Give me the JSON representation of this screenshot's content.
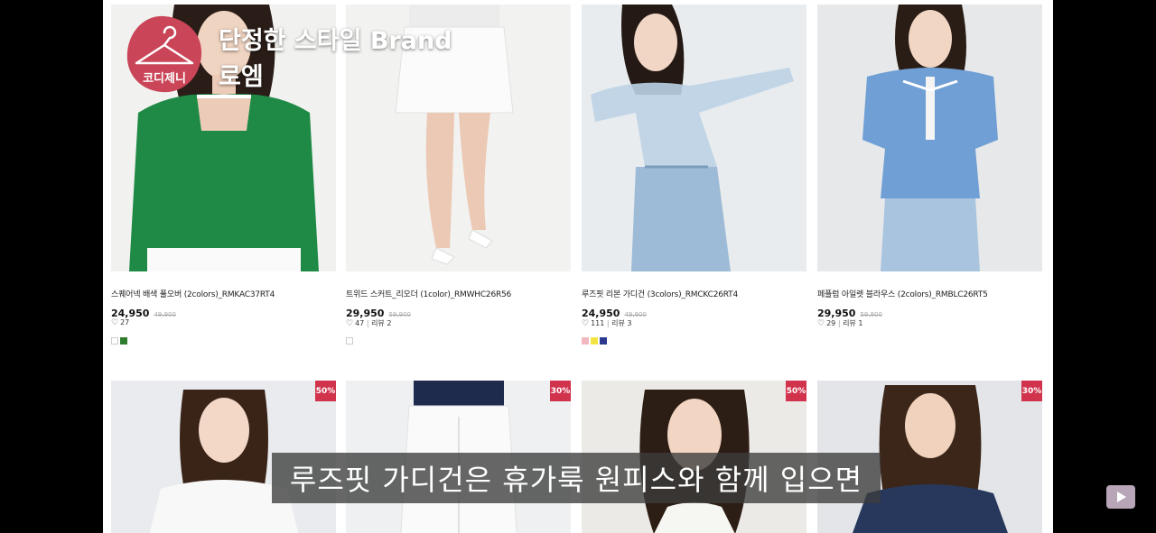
{
  "overlay": {
    "logo_text": "코디제니",
    "brand_title": "단정한 스타일 Brand",
    "brand_name": "로엠",
    "subtitle": "루즈핏 가디건은 휴가룩 원피스와 함께 입으면"
  },
  "products_row1": [
    {
      "name": "스퀘어넥 배색 풀오버 (2colors)_RMKAC37RT4",
      "sale_price": "24,950",
      "original_price": "49,900",
      "likes": "27",
      "reviews": "",
      "swatches": [
        "#ffffff",
        "#2e7d2e"
      ]
    },
    {
      "name": "트위드 스커트_리오더 (1color)_RMWHC26R56",
      "sale_price": "29,950",
      "original_price": "59,900",
      "likes": "47",
      "reviews": "리뷰 2",
      "swatches": [
        "#ffffff"
      ]
    },
    {
      "name": "루즈핏 리본 가디건 (3colors)_RMCKC26RT4",
      "sale_price": "24,950",
      "original_price": "49,900",
      "likes": "111",
      "reviews": "리뷰 3",
      "swatches": [
        "#f2b8c0",
        "#f2e440",
        "#2b3a8c"
      ]
    },
    {
      "name": "페플럼 아일렛 블라우스 (2colors)_RMBLC26RT5",
      "sale_price": "29,950",
      "original_price": "59,900",
      "likes": "29",
      "reviews": "리뷰 1",
      "swatches": []
    }
  ],
  "products_row2": [
    {
      "badge": "50%"
    },
    {
      "badge": "30%"
    },
    {
      "badge": "50%"
    },
    {
      "badge": "30%"
    }
  ],
  "colors": {
    "badge": "#d1334d",
    "logo": "#c94557"
  },
  "icons": {
    "heart": "heart-icon",
    "play": "play-icon",
    "logo": "hanger-icon"
  }
}
